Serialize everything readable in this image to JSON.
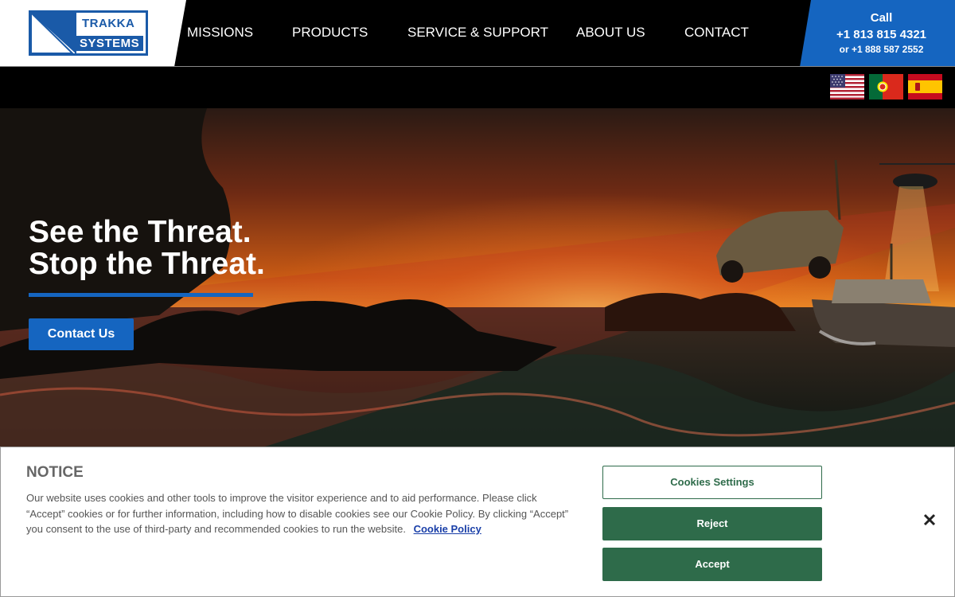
{
  "brand": {
    "line1": "TRAKKA",
    "line2": "SYSTEMS",
    "color": "#1a5aa8"
  },
  "nav": {
    "items": [
      "MISSIONS",
      "PRODUCTS",
      "SERVICE & SUPPORT",
      "ABOUT US",
      "CONTACT"
    ]
  },
  "call": {
    "label": "Call",
    "phone1": "+1 813 815 4321",
    "phone2": "or +1 888 587 2552",
    "color": "#1565c0"
  },
  "flags": [
    "us-flag-icon",
    "portugal-flag-icon",
    "spain-flag-icon"
  ],
  "hero": {
    "line1": "See the Threat.",
    "line2": "Stop the Threat.",
    "button": "Contact Us"
  },
  "cookie": {
    "title": "NOTICE",
    "text": "Our website uses cookies and other tools to improve the visitor experience and to aid performance. Please click “Accept” cookies or for further information, including how to disable cookies see our Cookie Policy. By clicking “Accept” you consent to the use of third-party and recommended cookies to run the website.",
    "policy_link": "Cookie Policy",
    "settings_button": "Cookies Settings",
    "reject_button": "Reject",
    "accept_button": "Accept",
    "accent": "#2e6b4a"
  }
}
